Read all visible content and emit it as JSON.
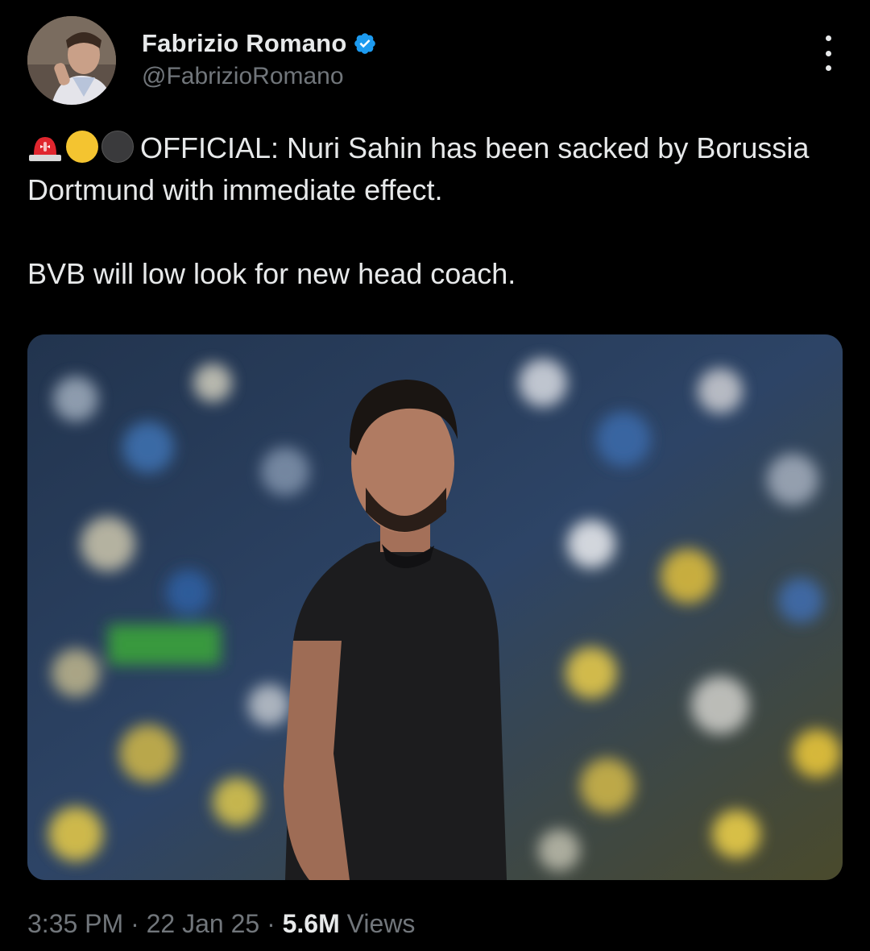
{
  "author": {
    "display_name": "Fabrizio Romano",
    "handle": "@FabrizioRomano",
    "verified": true,
    "avatar_icon": "profile-photo"
  },
  "tweet": {
    "emojis": [
      "siren-emoji",
      "yellow-circle-emoji",
      "black-circle-emoji"
    ],
    "line1": "OFFICIAL: Nuri Sahin has been sacked by Borussia Dortmund with immediate effect.",
    "line2": "BVB will low look for new head coach."
  },
  "media": {
    "description_icon": "photo-icon"
  },
  "meta": {
    "time": "3:35 PM",
    "separator1": " · ",
    "date": "22 Jan 25",
    "separator2": " · ",
    "views_count": "5.6M",
    "views_label": " Views"
  },
  "colors": {
    "background": "#000000",
    "text_primary": "#e7e9ea",
    "text_secondary": "#71767b",
    "verified_blue": "#1d9bf0"
  }
}
